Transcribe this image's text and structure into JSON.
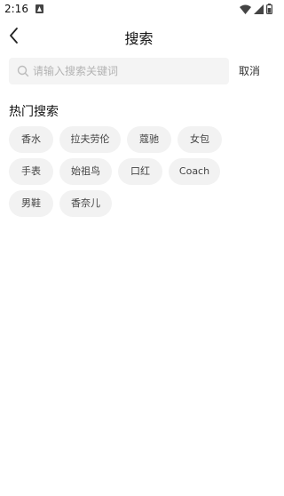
{
  "status_bar": {
    "time": "2:16"
  },
  "nav": {
    "title": "搜索"
  },
  "search": {
    "placeholder": "请输入搜索关键词",
    "value": "",
    "cancel_label": "取消"
  },
  "hot": {
    "title": "热门搜索",
    "tags": [
      "香水",
      "拉夫劳伦",
      "蔻驰",
      "女包",
      "手表",
      "始祖鸟",
      "口红",
      "Coach",
      "男鞋",
      "香奈儿"
    ]
  },
  "colors": {
    "tag_bg": "#f2f2f2",
    "search_bg": "#f4f4f4",
    "text": "#222222"
  }
}
